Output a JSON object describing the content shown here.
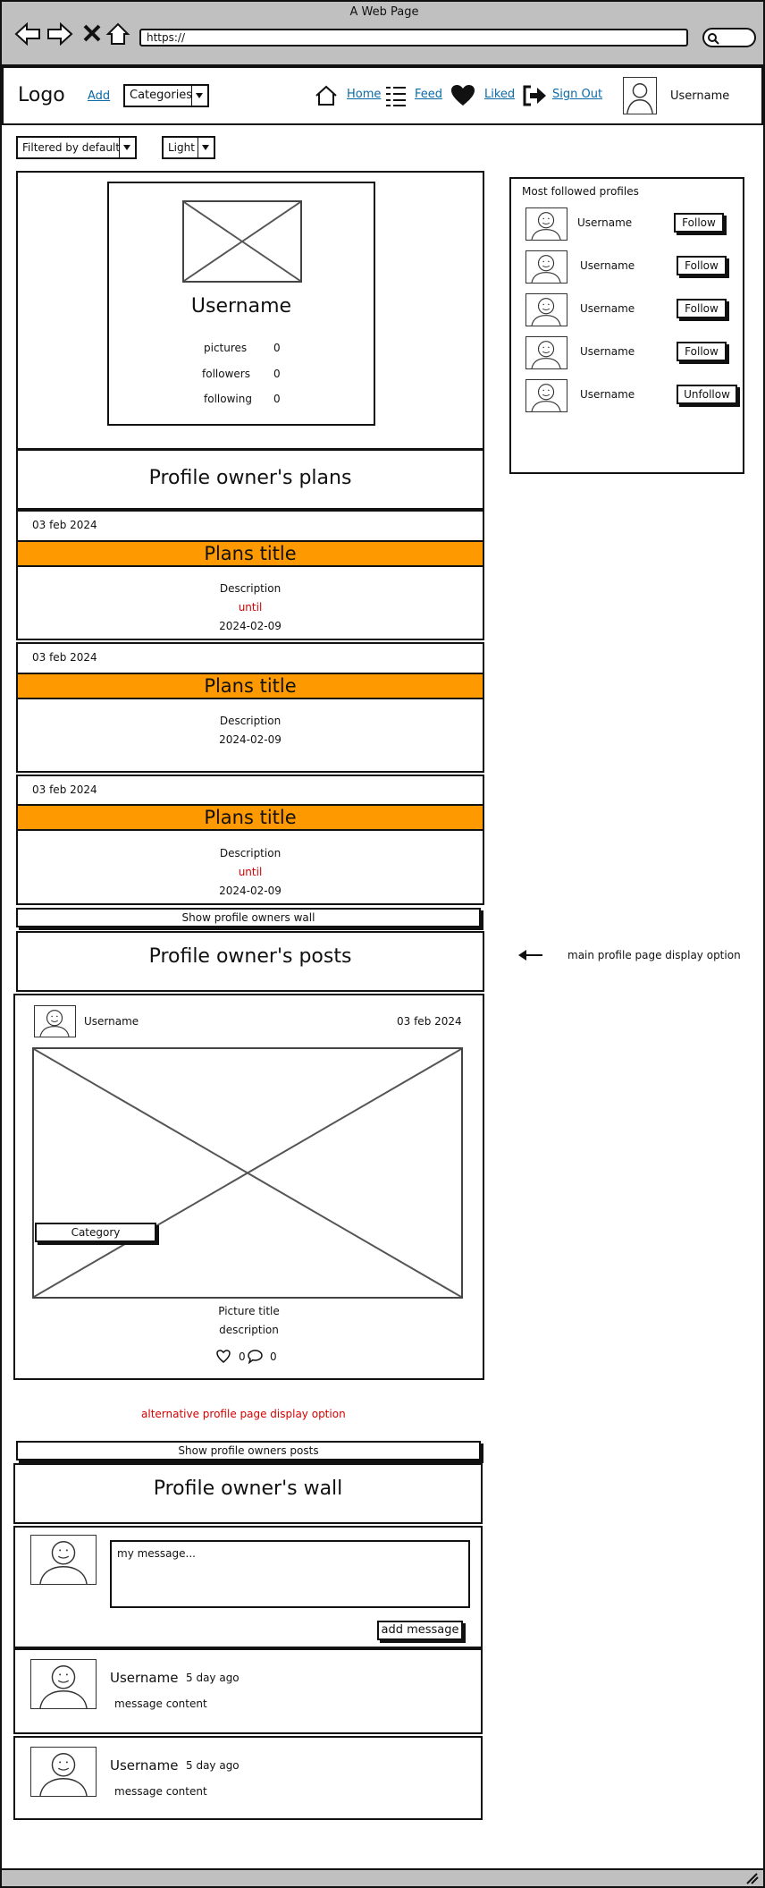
{
  "browser": {
    "title": "A Web Page",
    "url": "https://"
  },
  "header": {
    "logo": "Logo",
    "add": "Add",
    "categories": "Categories",
    "home": "Home",
    "feed": "Feed",
    "liked": "Liked",
    "sign_out": "Sign Out",
    "username": "Username"
  },
  "filters": {
    "filter_value": "Filtered by default",
    "theme_value": "Light"
  },
  "profile": {
    "username": "Username",
    "stats": [
      {
        "label": "pictures",
        "value": "0"
      },
      {
        "label": "followers",
        "value": "0"
      },
      {
        "label": "following",
        "value": "0"
      }
    ]
  },
  "plans": {
    "heading": "Profile owner's plans",
    "items": [
      {
        "date": "03 feb 2024",
        "title": "Plans title",
        "description": "Description",
        "until": "until",
        "end_date": "2024-02-09"
      },
      {
        "date": "03 feb 2024",
        "title": "Plans title",
        "description": "Description",
        "until": "",
        "end_date": "2024-02-09"
      },
      {
        "date": "03 feb 2024",
        "title": "Plans title",
        "description": "Description",
        "until": "until",
        "end_date": "2024-02-09"
      }
    ],
    "show_wall_button": "Show profile owners wall"
  },
  "posts": {
    "heading": "Profile owner's posts",
    "annotation": "main profile page display option",
    "post": {
      "username": "Username",
      "date": "03 feb 2024",
      "category": "Category",
      "title": "Picture title",
      "description": "description",
      "likes": "0",
      "comments": "0"
    }
  },
  "alternative_label": "alternative profile page display option",
  "wall": {
    "show_posts_button": "Show profile owners posts",
    "heading": "Profile owner's wall",
    "placeholder": "my message...",
    "add_button": "add message",
    "messages": [
      {
        "username": "Username",
        "time": "5 day ago",
        "content": "message content"
      },
      {
        "username": "Username",
        "time": "5 day ago",
        "content": "message content"
      }
    ]
  },
  "sidebar": {
    "title": "Most followed profiles",
    "profiles": [
      {
        "username": "Username",
        "action": "Follow"
      },
      {
        "username": "Username",
        "action": "Follow"
      },
      {
        "username": "Username",
        "action": "Follow"
      },
      {
        "username": "Username",
        "action": "Follow"
      },
      {
        "username": "Username",
        "action": "Unfollow"
      }
    ]
  },
  "colors": {
    "accent": "#ff9900",
    "link": "#0b6aa8",
    "warning_text": "#d40000",
    "chrome": "#c0c0c0"
  }
}
